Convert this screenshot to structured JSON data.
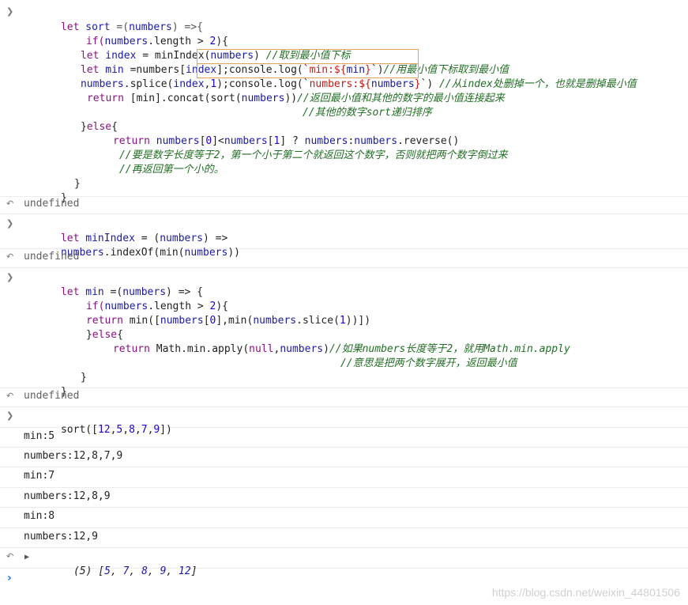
{
  "block1": {
    "l1": [
      "let ",
      "sort",
      " =(",
      "numbers",
      ") =>{"
    ],
    "l2": [
      "if(",
      "numbers",
      ".length > ",
      "2",
      "){"
    ],
    "l3": [
      "let ",
      "index",
      " = minIndex(",
      "numbers",
      ") ",
      "//取到最小值下标"
    ],
    "l4": [
      "let ",
      "min",
      " =numbers[",
      "index",
      "]",
      ";",
      "console.log(`",
      "min:${",
      "min",
      "}",
      "`)",
      "//用最小值下标取到最小值"
    ],
    "l5": [
      "numbers",
      ".splice(",
      "index",
      ",",
      "1",
      ")",
      ";",
      "console.log(`",
      "numbers:${",
      "numbers",
      "}",
      "`)",
      " //从index处删掉一个，也就是删掉最小值"
    ],
    "l6": [
      "return ",
      "[min].concat(sort(",
      "numbers",
      "))",
      "//返回最小值和其他的数字的最小值连接起来"
    ],
    "l7": [
      "//其他的数字sort递归排序"
    ],
    "l8": [
      "}",
      "else",
      "{"
    ],
    "l9": [
      "return ",
      "numbers",
      "[",
      "0",
      "]<",
      "numbers",
      "[",
      "1",
      "] ? ",
      "numbers",
      ":",
      "numbers",
      ".reverse()"
    ],
    "l10": [
      "//要是数字长度等于2，第一个小于第二个就返回这个数字，否则就把两个数字倒过来"
    ],
    "l11": [
      "//再返回第一个小的。"
    ],
    "l12": "}",
    "l13": "}"
  },
  "result1": "undefined",
  "block2": {
    "l1": [
      "let ",
      "minIndex",
      " = (",
      "numbers",
      ") =>"
    ],
    "l2": [
      "numbers",
      ".indexOf(min(",
      "numbers",
      "))"
    ]
  },
  "result2": "undefined",
  "block3": {
    "l1": [
      "let ",
      "min",
      " =(",
      "numbers",
      ") => {"
    ],
    "l2": [
      "if(",
      "numbers",
      ".length > ",
      "2",
      "){"
    ],
    "l3": [
      "return ",
      "min([",
      "numbers",
      "[",
      "0",
      "],min(",
      "numbers",
      ".slice(",
      "1",
      "))])"
    ],
    "l4": [
      "}",
      "else",
      "{"
    ],
    "l5": [
      "return ",
      "Math.min.apply(",
      "null",
      ",",
      "numbers",
      ")",
      "//如果numbers长度等于2，就用Math.min.apply"
    ],
    "l6": [
      "//意思是把两个数字展开，返回最小值"
    ],
    "l7": "}",
    "l8": "}"
  },
  "result3": "undefined",
  "call": [
    "sort([",
    "12",
    ",",
    "5",
    ",",
    "8",
    ",",
    "7",
    ",",
    "9",
    "])"
  ],
  "logs": [
    "min:5",
    "numbers:12,8,7,9",
    "min:7",
    "numbers:12,8,9",
    "min:8",
    "numbers:12,9"
  ],
  "final_result": {
    "count": "(5)",
    "values": [
      "5",
      "7",
      "8",
      "9",
      "12"
    ]
  },
  "icons": {
    "input_chevron": "chevron-right-icon",
    "result_arrow": "return-arrow-icon",
    "expand_triangle": "triangle-right-icon"
  },
  "watermark": "https://blog.csdn.net/weixin_44801506"
}
